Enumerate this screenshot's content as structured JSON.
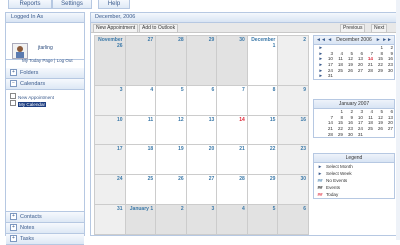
{
  "tabs": [
    "Reports",
    "Settings",
    "Help"
  ],
  "sidebar": {
    "logged_in_label": "Logged In As",
    "username": "jtarling",
    "links": "My Today Page | Log Out",
    "folders": "Folders",
    "calendars": "Calendars",
    "new_appointment": "New Appointment",
    "my_calendar": "My Calendar",
    "contacts": "Contacts",
    "notes": "Notes",
    "tasks": "Tasks"
  },
  "main": {
    "month_title": "December, 2006",
    "new_appointment": "New Appointment",
    "add_to_outlook": "Add to Outlook",
    "previous": "Previous",
    "next": "Next"
  },
  "month_grid": [
    [
      "November 26",
      "27",
      "28",
      "29",
      "30",
      "December 1",
      "2"
    ],
    [
      "3",
      "4",
      "5",
      "6",
      "7",
      "8",
      "9"
    ],
    [
      "10",
      "11",
      "12",
      "13",
      "14",
      "15",
      "16"
    ],
    [
      "17",
      "18",
      "19",
      "20",
      "21",
      "22",
      "23"
    ],
    [
      "24",
      "25",
      "26",
      "27",
      "28",
      "29",
      "30"
    ],
    [
      "31",
      "January 1",
      "2",
      "3",
      "4",
      "5",
      "6"
    ]
  ],
  "mini_dec": {
    "title": "December 2006",
    "nav_left": "◄◄ ◄",
    "nav_right": "► ►►",
    "rows": [
      [
        "",
        "",
        "",
        "",
        "",
        "1",
        "2"
      ],
      [
        "3",
        "4",
        "5",
        "6",
        "7",
        "8",
        "9"
      ],
      [
        "10",
        "11",
        "12",
        "13",
        "14",
        "15",
        "16"
      ],
      [
        "17",
        "18",
        "19",
        "20",
        "21",
        "22",
        "23"
      ],
      [
        "24",
        "25",
        "26",
        "27",
        "28",
        "29",
        "30"
      ],
      [
        "31",
        "",
        "",
        "",
        "",
        "",
        ""
      ]
    ]
  },
  "mini_jan": {
    "title": "January 2007",
    "rows": [
      [
        "",
        "1",
        "2",
        "3",
        "4",
        "5",
        "6"
      ],
      [
        "7",
        "8",
        "9",
        "10",
        "11",
        "12",
        "13"
      ],
      [
        "14",
        "15",
        "16",
        "17",
        "18",
        "19",
        "20"
      ],
      [
        "21",
        "22",
        "23",
        "24",
        "25",
        "26",
        "27"
      ],
      [
        "28",
        "29",
        "30",
        "31",
        "",
        "",
        ""
      ]
    ]
  },
  "legend": {
    "title": "Legend",
    "items": [
      {
        "symbol": "►",
        "label": "Select Month"
      },
      {
        "symbol": "►",
        "label": "Select Week"
      },
      {
        "symbol": "##",
        "label": "No Events"
      },
      {
        "symbol": "##",
        "label": "Events"
      },
      {
        "symbol": "##",
        "label": "Today"
      }
    ]
  },
  "colors": {
    "accent": "#3a5a8c",
    "day_number": "#3a78a8",
    "today": "#dd2233",
    "other_month_bg": "#e2e2e2",
    "selected_calendar_bg": "#1d3e82"
  }
}
